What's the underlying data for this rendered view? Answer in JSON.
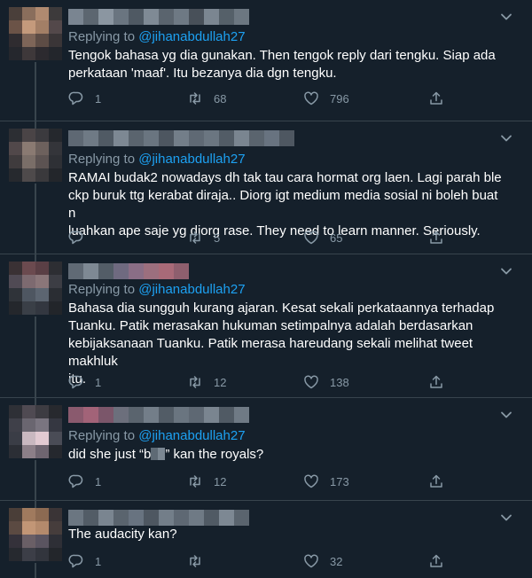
{
  "icons": {
    "reply": "reply-icon",
    "retweet": "retweet-icon",
    "like": "like-icon",
    "share": "share-icon",
    "more": "chevron-down-icon"
  },
  "colors": {
    "background": "#15202b",
    "divider": "#38444d",
    "muted": "#8899a6",
    "link": "#1da1f2"
  },
  "tweets": [
    {
      "replying_label": "Replying to",
      "replying_handle": "@jihanabdullah27",
      "lines": [
        "Tengok bahasa yg dia gunakan. Then tengok reply dari tengku. Siap ada",
        "perkataan 'maaf'. Itu bezanya dia dgn tengku."
      ],
      "replies": "1",
      "retweets": "68",
      "likes": "796"
    },
    {
      "replying_label": "Replying to",
      "replying_handle": "@jihanabdullah27",
      "lines": [
        "RAMAI budak2 nowadays dh tak tau cara hormat org laen. Lagi parah ble",
        "ckp buruk ttg kerabat diraja.. Diorg igt medium media sosial ni boleh buat n",
        "luahkan ape saje yg diorg rase. They need to learn manner. Seriously."
      ],
      "replies": "",
      "retweets": "5",
      "likes": "65"
    },
    {
      "replying_label": "Replying to",
      "replying_handle": "@jihanabdullah27",
      "lines": [
        "Bahasa dia sungguh kurang ajaran. Kesat sekali perkataannya terhadap",
        "Tuanku. Patik merasakan hukuman setimpalnya adalah berdasarkan",
        "kebijaksanaan Tuanku. Patik merasa hareudang sekali melihat tweet makhluk",
        "itu."
      ],
      "replies": "1",
      "retweets": "12",
      "likes": "138"
    },
    {
      "replying_label": "Replying to",
      "replying_handle": "@jihanabdullah27",
      "text_before": "did she just “b",
      "text_after": "” kan the royals?",
      "replies": "1",
      "retweets": "12",
      "likes": "173"
    },
    {
      "lines": [
        "The audacity kan?"
      ],
      "replies": "1",
      "retweets": "",
      "likes": "32"
    }
  ]
}
